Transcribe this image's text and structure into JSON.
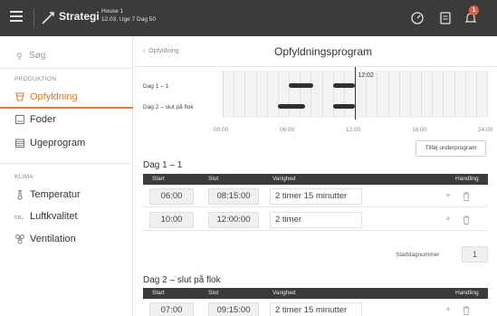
{
  "topbar": {
    "title": "Strategi",
    "house": "House 1",
    "subtitle": "12.03, Uge 7 Dag 50",
    "notification_count": "1"
  },
  "sidebar": {
    "search_placeholder": "Søg",
    "sections": [
      {
        "label": "PRODUKTION"
      },
      {
        "label": "KLIMA"
      }
    ],
    "items": [
      {
        "label": "Opfyldning",
        "icon": "cup-icon",
        "active": true
      },
      {
        "label": "Foder",
        "icon": "feed-icon"
      },
      {
        "label": "Ugeprogram",
        "icon": "calendar-icon"
      },
      {
        "label": "Temperatur",
        "icon": "thermometer-icon"
      },
      {
        "label": "Luftkvalitet",
        "icon": "co2-icon"
      },
      {
        "label": "Ventilation",
        "icon": "fan-icon"
      }
    ]
  },
  "main": {
    "back_label": "Opfyldning",
    "title": "Opfyldningsprogram",
    "add_button": "Tilføj underprogram",
    "start_day_label": "Startdagnummer",
    "start_day_value": "1"
  },
  "timeline": {
    "rows": [
      "Dag 1 – 1",
      "Dag 2 – slut på flok"
    ],
    "axis": [
      "00:00",
      "06:00",
      "12:00",
      "18:00",
      "24:00"
    ],
    "now_label": "12:02",
    "now_hours": 12.03,
    "bars": [
      {
        "row": 0,
        "start_h": 6.0,
        "end_h": 8.25
      },
      {
        "row": 0,
        "start_h": 10.0,
        "end_h": 12.0
      },
      {
        "row": 1,
        "start_h": 5.0,
        "end_h": 7.5
      },
      {
        "row": 1,
        "start_h": 10.0,
        "end_h": 12.0
      }
    ]
  },
  "tables": [
    {
      "title": "Dag 1 – 1",
      "headers": [
        "Start",
        "Slut",
        "Varighed",
        "Handling"
      ],
      "rows": [
        {
          "start": "06:00",
          "end": "08:15:00",
          "duration": "2 timer 15 minutter"
        },
        {
          "start": "10:00",
          "end": "12:00:00",
          "duration": "2 timer"
        }
      ]
    },
    {
      "title": "Dag 2 – slut på flok",
      "headers": [
        "Start",
        "Slut",
        "Varighed",
        "Handling"
      ],
      "rows": [
        {
          "start": "07:00",
          "end": "09:15:00",
          "duration": "2 timer 15 minutter"
        }
      ]
    }
  ],
  "icons": {
    "add": "+",
    "delete": "🗑"
  }
}
